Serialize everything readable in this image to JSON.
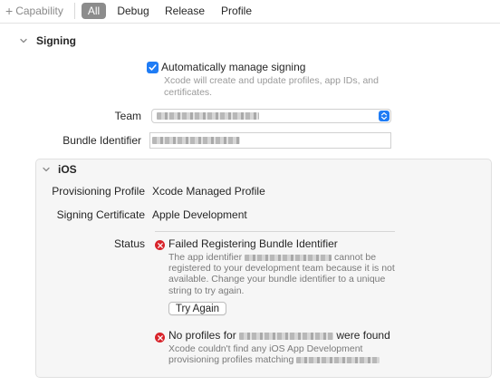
{
  "toolbar": {
    "capability_label": "Capability",
    "tabs": [
      {
        "label": "All",
        "active": true
      },
      {
        "label": "Debug",
        "active": false
      },
      {
        "label": "Release",
        "active": false
      },
      {
        "label": "Profile",
        "active": false
      }
    ]
  },
  "signing": {
    "title": "Signing",
    "auto_manage_label": "Automatically manage signing",
    "auto_manage_checked": true,
    "auto_manage_hint": "Xcode will create and update profiles, app IDs, and certificates.",
    "team_label": "Team",
    "bundle_id_label": "Bundle Identifier"
  },
  "ios": {
    "title": "iOS",
    "provisioning_label": "Provisioning Profile",
    "provisioning_value": "Xcode Managed Profile",
    "certificate_label": "Signing Certificate",
    "certificate_value": "Apple Development",
    "status_label": "Status",
    "errors": [
      {
        "title": "Failed Registering Bundle Identifier",
        "body_prefix": "The app identifier",
        "body_suffix": "cannot be",
        "body_rest": "registered to your development team because it is not available. Change your bundle identifier to a unique string to try again.",
        "button": "Try Again"
      },
      {
        "title_prefix": "No profiles for",
        "title_suffix": "were found",
        "body": "Xcode couldn't find any iOS App Development provisioning profiles matching"
      }
    ]
  },
  "colors": {
    "accent": "#1f7cf5",
    "error": "#d8232a",
    "segment_active": "#8c8c8c"
  }
}
